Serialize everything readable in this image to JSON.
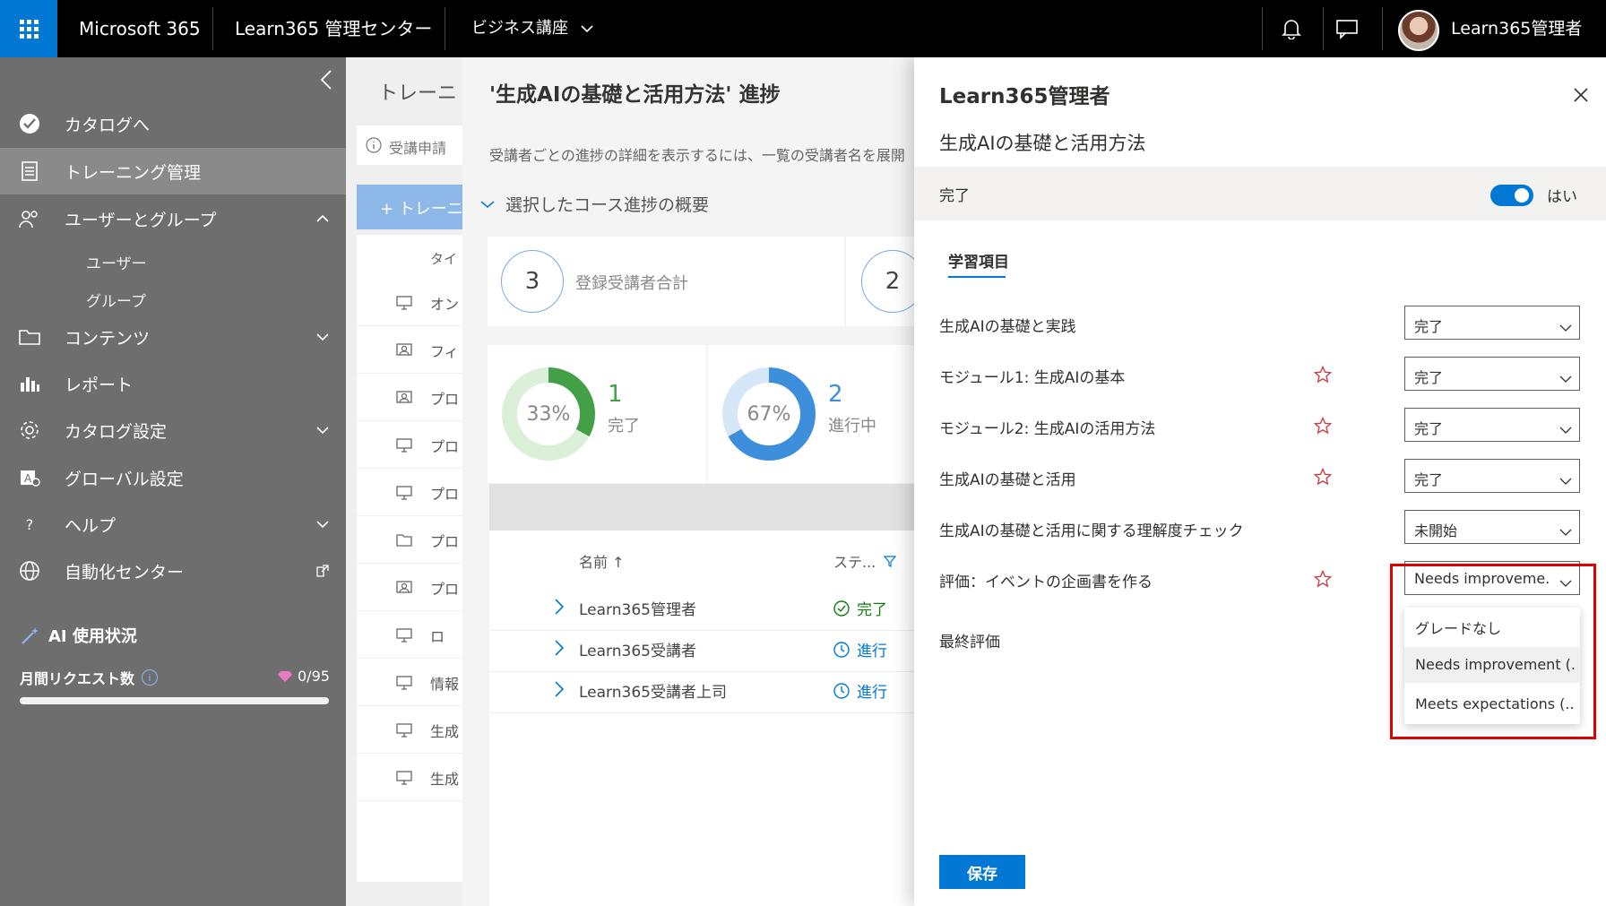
{
  "topbar": {
    "app_name": "Microsoft 365",
    "admin_center": "Learn365 管理センター",
    "nav_menu": "ビジネス講座",
    "user_name": "Learn365管理者"
  },
  "sidebar": {
    "items": [
      {
        "label": "カタログへ",
        "icon": "catalog-check-icon"
      },
      {
        "label": "トレーニング管理",
        "icon": "training-doc-icon"
      },
      {
        "label": "ユーザーとグループ",
        "icon": "users-icon"
      },
      {
        "label": "コンテンツ",
        "icon": "folder-icon"
      },
      {
        "label": "レポート",
        "icon": "chart-icon"
      },
      {
        "label": "カタログ設定",
        "icon": "gear-icon"
      },
      {
        "label": "グローバル設定",
        "icon": "global-settings-icon"
      },
      {
        "label": "ヘルプ",
        "icon": "help-icon"
      },
      {
        "label": "自動化センター",
        "icon": "globe-icon"
      }
    ],
    "subitems": [
      "ユーザー",
      "グループ"
    ],
    "ai_title": "AI 使用状況",
    "monthly_requests_label": "月間リクエスト数",
    "monthly_requests_value": "0/95"
  },
  "background_page": {
    "title": "トレーニ",
    "info_text": "受講申請",
    "add_button": "+ トレーニ",
    "header_col": "タイ",
    "rows": [
      "オン",
      "フィ",
      "プロ",
      "プロ",
      "プロ",
      "プロ",
      "プロ",
      "ロ",
      "情報",
      "生成",
      "生成"
    ]
  },
  "progress_panel": {
    "title": "'生成AIの基礎と活用方法' 進捗",
    "description": "受講者ごとの進捗の詳細を表示するには、一覧の受講者名を展開",
    "section_label": "選択したコース進捗の概要",
    "total_enrolled": {
      "value": "3",
      "label": "登録受講者合計"
    },
    "second_total": "2",
    "completed": {
      "percent": "33%",
      "count": "1",
      "label": "完了",
      "fraction": 0.33
    },
    "in_progress": {
      "percent": "67%",
      "count": "2",
      "label": "進行中",
      "fraction": 0.67
    },
    "table": {
      "col_name": "名前 ↑",
      "col_status": "ステ...",
      "rows": [
        {
          "name": "Learn365管理者",
          "status": "完了",
          "status_color": "#107c10"
        },
        {
          "name": "Learn365受講者",
          "status": "進行",
          "status_color": "#0078d4"
        },
        {
          "name": "Learn365受講者上司",
          "status": "進行",
          "status_color": "#0078d4"
        }
      ]
    }
  },
  "detail_panel": {
    "title": "Learn365管理者",
    "subtitle": "生成AIの基礎と活用方法",
    "complete_label": "完了",
    "toggle_label": "はい",
    "tab_label": "学習項目",
    "items": [
      {
        "label": "生成AIの基礎と実践",
        "value": "完了",
        "star": false
      },
      {
        "label": "モジュール1: 生成AIの基本",
        "value": "完了",
        "star": true
      },
      {
        "label": "モジュール2: 生成AIの活用方法",
        "value": "完了",
        "star": true
      },
      {
        "label": "生成AIの基礎と活用",
        "value": "完了",
        "star": true
      },
      {
        "label": "生成AIの基礎と活用に関する理解度チェック",
        "value": "未開始",
        "star": false
      },
      {
        "label": "評価：イベントの企画書を作る",
        "value": "Needs improveme...",
        "star": true
      }
    ],
    "final_label": "最終評価",
    "dropdown_options": [
      "グレードなし",
      "Needs improvement (...",
      "Meets expectations (..."
    ],
    "save_button": "保存"
  },
  "colors": {
    "accent": "#0078d4",
    "complete_green": "#43a047",
    "progress_blue": "#3d8fdb",
    "star_red": "#d13438",
    "highlight_red": "#e00000"
  }
}
